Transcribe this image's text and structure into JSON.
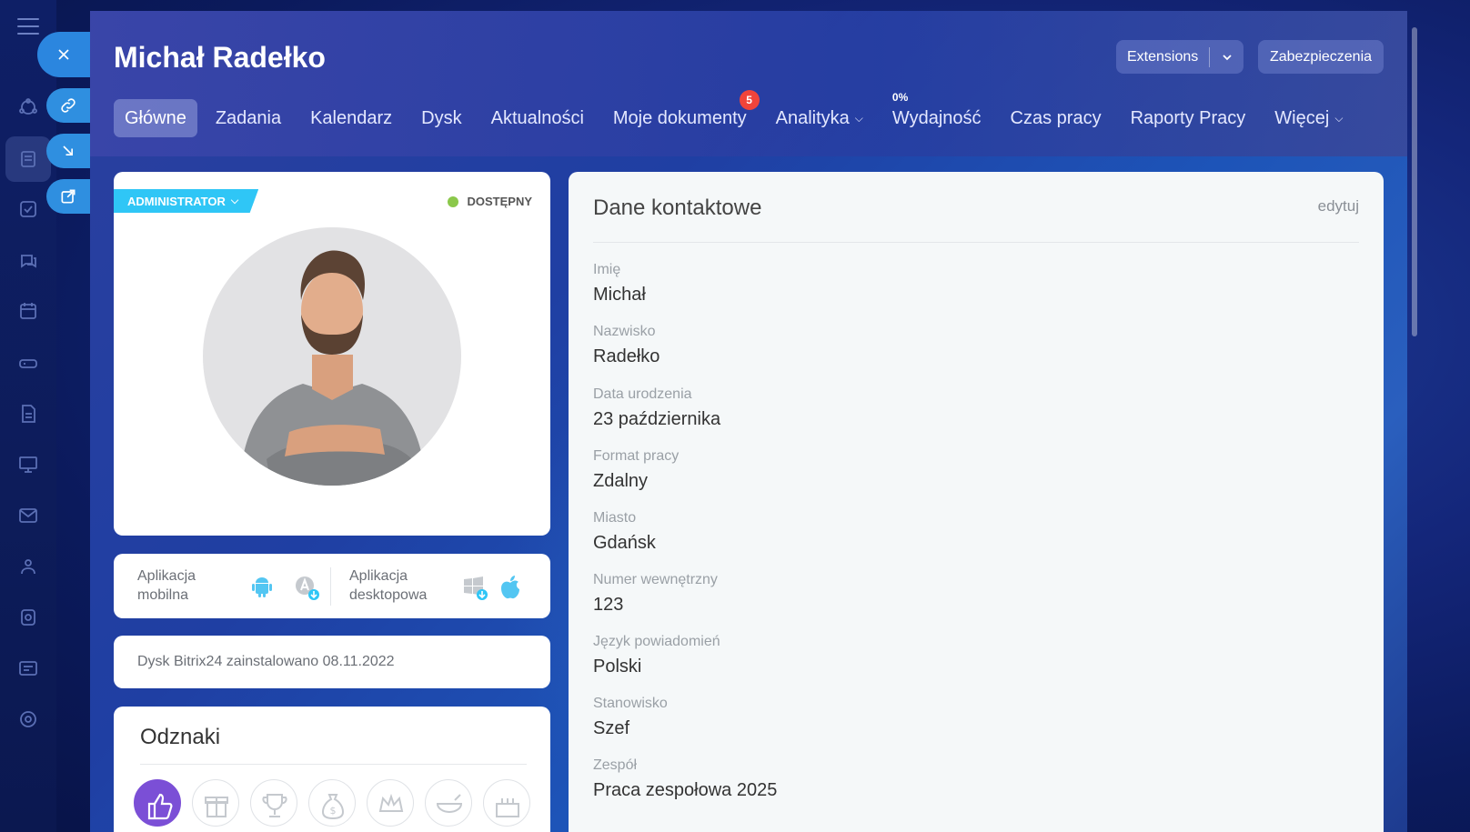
{
  "panel": {
    "title": "Michał Radełko",
    "extensions_label": "Extensions",
    "security_label": "Zabezpieczenia"
  },
  "tabs": [
    {
      "label": "Główne",
      "active": true
    },
    {
      "label": "Zadania"
    },
    {
      "label": "Kalendarz"
    },
    {
      "label": "Dysk"
    },
    {
      "label": "Aktualności"
    },
    {
      "label": "Moje dokumenty",
      "badge": "5"
    },
    {
      "label": "Analityka",
      "dropdown": true
    },
    {
      "label": "Wydajność",
      "percent": "0%"
    },
    {
      "label": "Czas pracy"
    },
    {
      "label": "Raporty Pracy"
    },
    {
      "label": "Więcej",
      "dropdown": true
    }
  ],
  "profile": {
    "role": "ADMINISTRATOR",
    "status": "DOSTĘPNY",
    "status_color": "#8bc84b"
  },
  "apps": {
    "mobile_label_1": "Aplikacja",
    "mobile_label_2": "mobilna",
    "desktop_label_1": "Aplikacja",
    "desktop_label_2": "desktopowa"
  },
  "disk": {
    "text": "Dysk Bitrix24 zainstalowano 08.11.2022"
  },
  "badges": {
    "title": "Odznaki"
  },
  "contact": {
    "title": "Dane kontaktowe",
    "edit": "edytuj",
    "fields": [
      {
        "label": "Imię",
        "value": "Michał"
      },
      {
        "label": "Nazwisko",
        "value": "Radełko"
      },
      {
        "label": "Data urodzenia",
        "value": "23 października"
      },
      {
        "label": "Format pracy",
        "value": "Zdalny"
      },
      {
        "label": "Miasto",
        "value": "Gdańsk"
      },
      {
        "label": "Numer wewnętrzny",
        "value": "123"
      },
      {
        "label": "Język powiadomień",
        "value": "Polski"
      },
      {
        "label": "Stanowisko",
        "value": "Szef"
      },
      {
        "label": "Zespół",
        "value": "Praca zespołowa 2025"
      }
    ]
  },
  "colors": {
    "accent": "#2fc6f6",
    "badge_red": "#f0443a",
    "side_button": "#2b86df"
  }
}
